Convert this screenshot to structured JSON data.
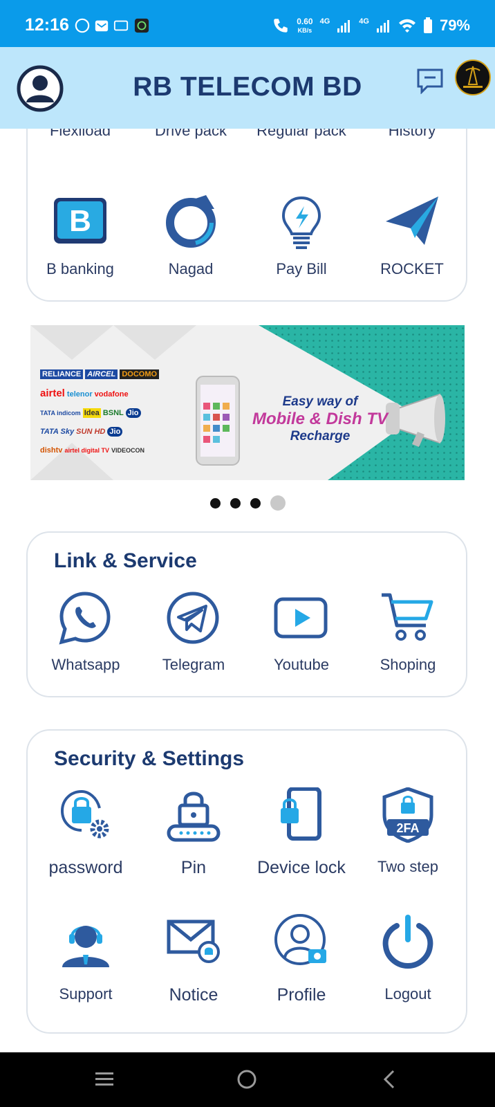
{
  "status_bar": {
    "time": "12:16",
    "speed": "0.60",
    "speed_unit": "KB/s",
    "net1": "4G",
    "net2": "4G",
    "battery": "79%"
  },
  "app_bar": {
    "title": "RB TELECOM BD"
  },
  "services_top": {
    "row1": [
      "Flexiload",
      "Drive pack",
      "Regular pack",
      "History"
    ],
    "row2": [
      "B banking",
      "Nagad",
      "Pay Bill",
      "ROCKET"
    ]
  },
  "banner": {
    "line1": "Easy way of",
    "line2": "Mobile & Dish TV",
    "line3": "Recharge",
    "brands": [
      "RELIANCE",
      "AIRCEL",
      "DOCOMO",
      "airtel",
      "telenor",
      "vodafone",
      "TATA indicom",
      "Idea",
      "BSNL",
      "Jio",
      "TATA Sky",
      "SUN HD",
      "Jio",
      "dishtv",
      "airtel digital TV",
      "VIDEOCON"
    ]
  },
  "carousel": {
    "count": 4,
    "active_index": 3
  },
  "link_service": {
    "title": "Link & Service",
    "items": [
      "Whatsapp",
      "Telegram",
      "Youtube",
      "Shoping"
    ]
  },
  "security": {
    "title": "Security & Settings",
    "row1": [
      "password",
      "Pin",
      "Device lock",
      "Two step"
    ],
    "row2": [
      "Support",
      "Notice",
      "Profile",
      "Logout"
    ],
    "badge_2fa": "2FA"
  },
  "colors": {
    "status_bar": "#0a9bea",
    "app_bar": "#bde6fb",
    "title": "#1c3a70",
    "icon_blue": "#2e5a9e",
    "icon_accent": "#25a8e6"
  }
}
